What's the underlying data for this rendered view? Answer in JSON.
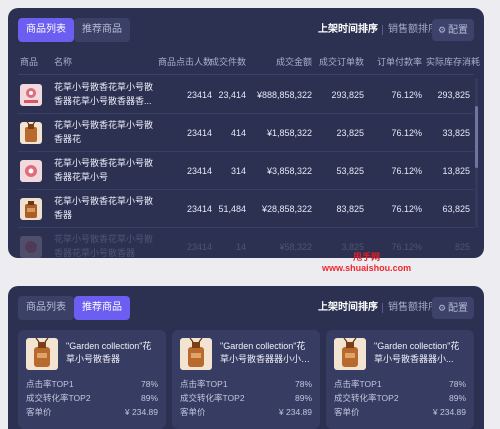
{
  "colors": {
    "background": "#ececf1",
    "panel": "#2c3152",
    "accent": "#6b5ef0",
    "watermark": "#e0202a"
  },
  "list_view": {
    "tabs": [
      {
        "label": "商品列表",
        "active": true
      },
      {
        "label": "推荐商品",
        "active": false
      }
    ],
    "sort_options": [
      {
        "label": "上架时间排序",
        "active": true
      },
      {
        "label": "销售额排序",
        "active": false
      }
    ],
    "config": {
      "icon": "gear-icon",
      "label": "配置"
    },
    "columns": [
      "商品",
      "名称",
      "商品点击人数",
      "成交件数",
      "成交金额",
      "成交订单数",
      "订单付款率",
      "实际库存消耗"
    ],
    "rows": [
      {
        "image": "pink-product",
        "name": "花草小号散香花草小号散香器花草小号散香器香...",
        "clicks": "23414",
        "units": "23,414",
        "amount": "¥888,858,322",
        "orders": "293,825",
        "pay_rate": "76.12%",
        "stock": "293,825"
      },
      {
        "image": "wood-product",
        "name": "花草小号散香花草小号散香器花",
        "clicks": "23414",
        "units": "414",
        "amount": "¥1,858,322",
        "orders": "23,825",
        "pay_rate": "76.12%",
        "stock": "33,825"
      },
      {
        "image": "pink-product",
        "name": "花草小号散香花草小号散香器花草小号",
        "clicks": "23414",
        "units": "314",
        "amount": "¥3,858,322",
        "orders": "53,825",
        "pay_rate": "76.12%",
        "stock": "13,825"
      },
      {
        "image": "wood-product",
        "name": "花草小号散香花草小号散香器",
        "clicks": "23414",
        "units": "51,484",
        "amount": "¥28,858,322",
        "orders": "83,825",
        "pay_rate": "76.12%",
        "stock": "63,825"
      },
      {
        "image": "pink-product",
        "name": "花草小号散香花草小号散香器花草小号散香器",
        "clicks": "23414",
        "units": "14",
        "amount": "¥58,322",
        "orders": "3,825",
        "pay_rate": "76.12%",
        "stock": "825"
      }
    ]
  },
  "watermark": {
    "brand": "甩手网",
    "url": "www.shuaishou.com"
  },
  "recommend_view": {
    "tabs": [
      {
        "label": "商品列表",
        "active": false
      },
      {
        "label": "推荐商品",
        "active": true
      }
    ],
    "sort_options": [
      {
        "label": "上架时间排序",
        "active": true
      },
      {
        "label": "销售额排序",
        "active": false
      }
    ],
    "config": {
      "icon": "gear-icon",
      "label": "配置"
    },
    "cards": [
      {
        "title": "\"Garden collection\"花 草小号散香器",
        "metrics": [
          {
            "label": "点击率TOP1",
            "value": "78%"
          },
          {
            "label": "成交转化率TOP2",
            "value": "89%"
          },
          {
            "label": "客单价",
            "value": "¥ 234.89"
          }
        ]
      },
      {
        "title": "\"Garden collection\"花 草小号散香器器小小号散香器器小器小器号散...",
        "metrics": [
          {
            "label": "点击率TOP1",
            "value": "78%"
          },
          {
            "label": "成交转化率TOP2",
            "value": "89%"
          },
          {
            "label": "客单价",
            "value": "¥ 234.89"
          }
        ]
      },
      {
        "title": "\"Garden collection\"花 草小号散香器器小...",
        "metrics": [
          {
            "label": "点击率TOP1",
            "value": "78%"
          },
          {
            "label": "成交转化率TOP2",
            "value": "89%"
          },
          {
            "label": "客单价",
            "value": "¥ 234.89"
          }
        ]
      }
    ]
  }
}
